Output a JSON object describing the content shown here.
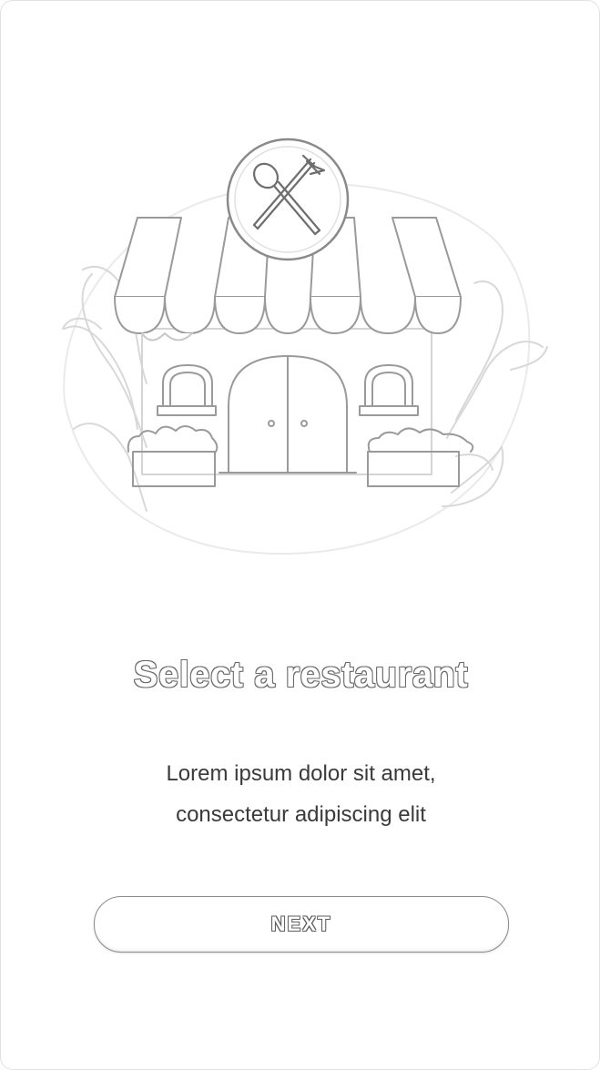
{
  "onboarding": {
    "title": "Select a restaurant",
    "subtitle_line1": "Lorem ipsum dolor sit amet,",
    "subtitle_line2": "consectetur adipiscing elit",
    "next_label": "NEXT"
  },
  "icons": {
    "illustration": "restaurant-storefront-icon",
    "badge": "spoon-fork-icon"
  }
}
